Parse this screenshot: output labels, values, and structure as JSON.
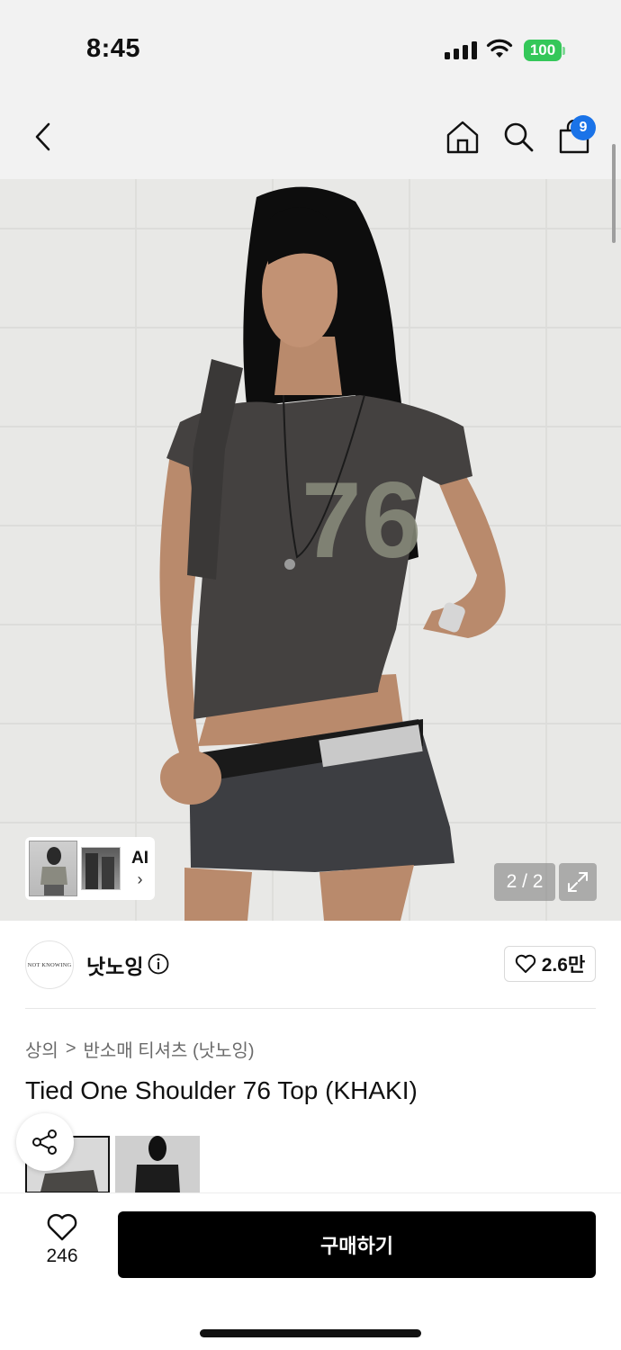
{
  "status": {
    "time": "8:45",
    "battery": "100"
  },
  "nav": {
    "cart_count": "9"
  },
  "gallery": {
    "counter": "2 / 2",
    "ai_label": "AI",
    "shirt_number": "76"
  },
  "brand": {
    "logo_text": "NOT KNOWING",
    "name": "낫노잉",
    "likes": "2.6만"
  },
  "breadcrumb": {
    "category": "상의",
    "separator": ">",
    "subcategory": "반소매 티셔츠 (낫노잉)"
  },
  "product": {
    "title": "Tied One Shoulder 76 Top (KHAKI)"
  },
  "bottom": {
    "wish_count": "246",
    "buy_label": "구매하기"
  },
  "colors": {
    "accent_blue": "#1a73e8",
    "battery_green": "#34c759",
    "buy_bg": "#000000"
  }
}
